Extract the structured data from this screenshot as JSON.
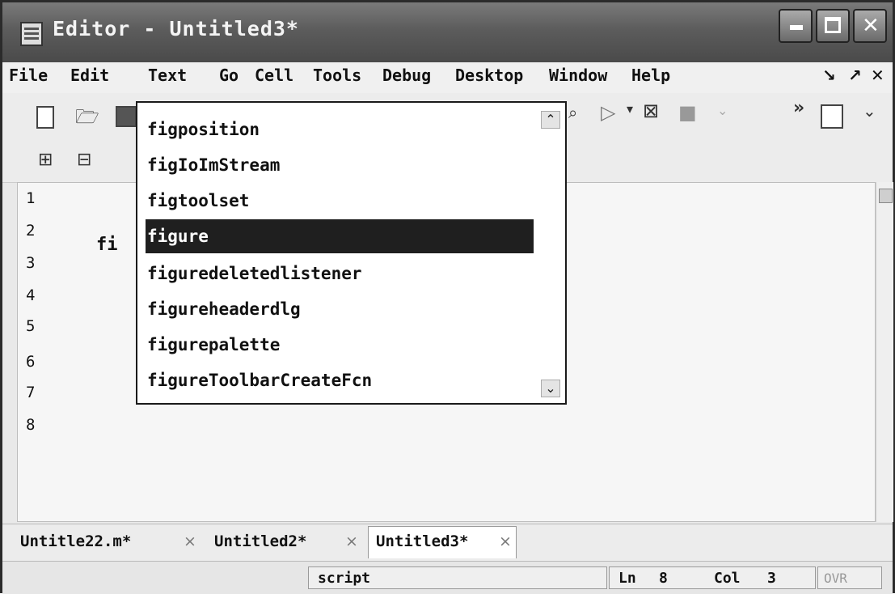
{
  "window": {
    "title": "Editor - Untitled3*"
  },
  "menu": {
    "items": [
      "File",
      "Edit",
      "Text",
      "Go",
      "Cell",
      "Tools",
      "Debug",
      "Desktop",
      "Window",
      "Help"
    ]
  },
  "editor": {
    "line_numbers": [
      "1",
      "2",
      "3",
      "4",
      "5",
      "6",
      "7",
      "8"
    ],
    "current_line_text": "fi"
  },
  "autocomplete": {
    "items": [
      "figposition",
      "figIoImStream",
      "figtoolset",
      "figure",
      "figuredeletedlistener",
      "figureheaderdlg",
      "figurepalette",
      "figureToolbarCreateFcn"
    ],
    "selected_index": 3
  },
  "tabs": [
    {
      "label": "Untitle22.m*",
      "close": "×"
    },
    {
      "label": "Untitled2*",
      "close": "×"
    },
    {
      "label": "Untitled3*",
      "close": "×"
    }
  ],
  "status": {
    "mode": "script",
    "ln_label": "Ln",
    "ln_value": "8",
    "col_label": "Col",
    "col_value": "3",
    "ovr": "OVR"
  },
  "icons": [
    "app-icon",
    "new-file-icon",
    "open-file-icon",
    "save-icon",
    "run-icon",
    "step-icon",
    "cell-insert-icon",
    "cell-delete-icon",
    "minimize-icon",
    "maximize-icon",
    "close-icon"
  ]
}
